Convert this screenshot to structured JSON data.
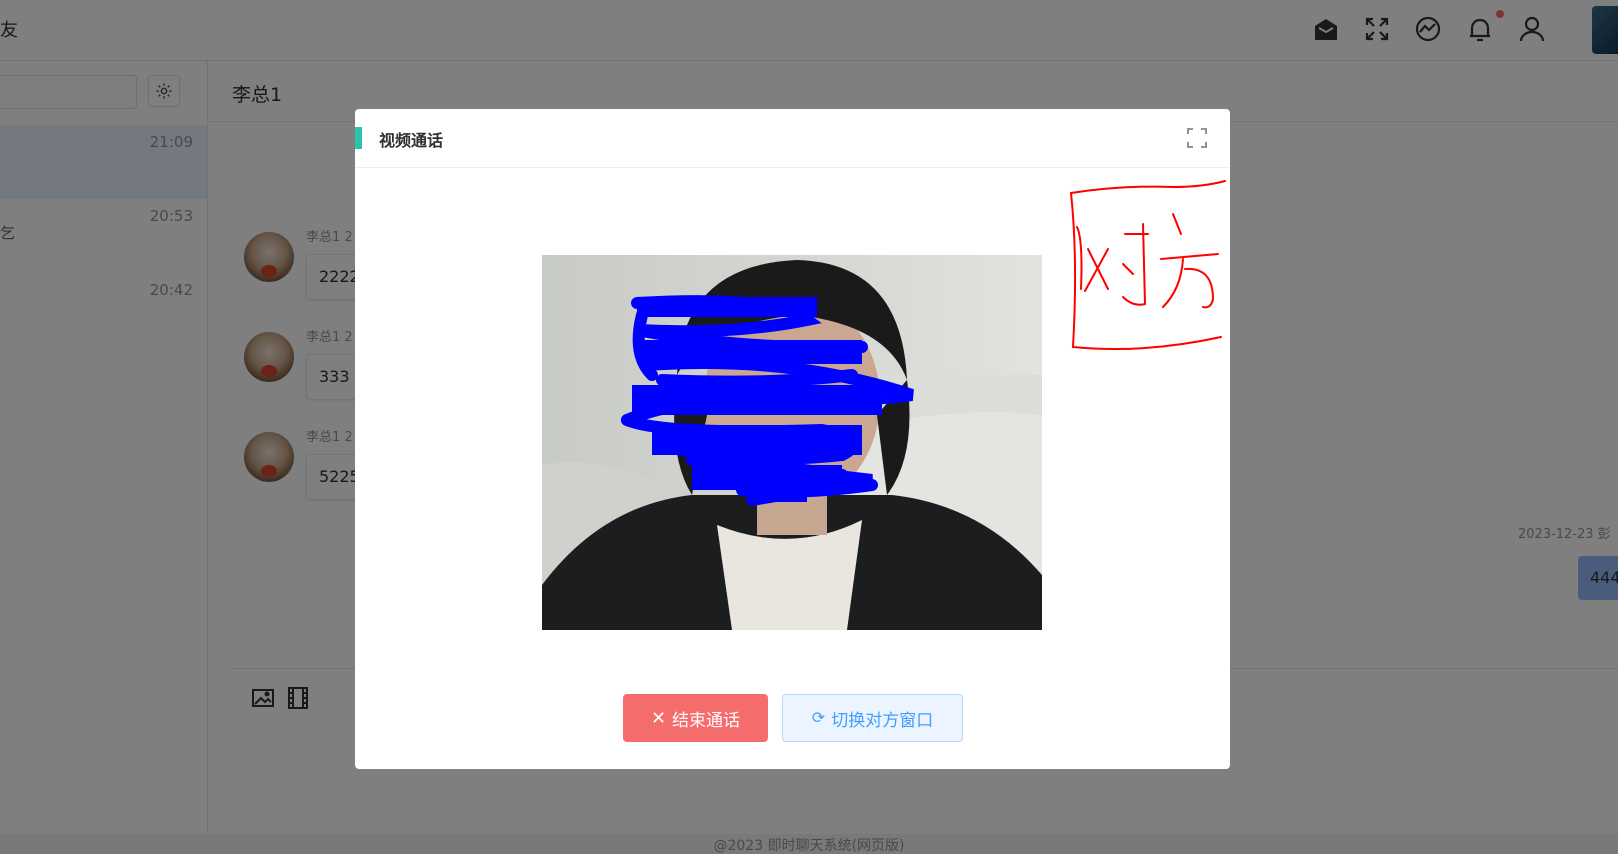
{
  "header": {
    "title_fragment": "友",
    "icons": [
      "mail-open-icon",
      "fullscreen-icon",
      "theme-icon",
      "bell-icon",
      "user-icon"
    ]
  },
  "sidebar": {
    "conversations": [
      {
        "time": "21:09",
        "active": true,
        "fragment": ""
      },
      {
        "time": "20:53",
        "active": false,
        "fragment": "乞"
      },
      {
        "time": "20:42",
        "active": false,
        "fragment": ""
      }
    ]
  },
  "chat": {
    "contact_name": "李总1",
    "messages": [
      {
        "sender": "李总1 2",
        "text": "2222"
      },
      {
        "sender": "李总1 2",
        "text": "333"
      },
      {
        "sender": "李总1 2",
        "text": "5225"
      }
    ],
    "right_timestamp": "2023-12-23 彭",
    "right_message": "444"
  },
  "footer": {
    "text": "@2023 即时聊天系统(网页版)"
  },
  "dialog": {
    "title": "视频通话",
    "annotation": "对方",
    "end_call_label": "结束通话",
    "switch_label": "切换对方窗口",
    "colors": {
      "accent": "#29c4a9",
      "danger": "#f56c6c",
      "primary": "#409eff",
      "redaction": "#0000ff",
      "annotation": "#ff0000"
    }
  }
}
